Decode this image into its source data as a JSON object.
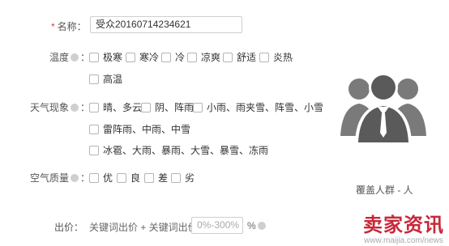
{
  "name_field": {
    "required_mark": "*",
    "label": "名称：",
    "value": "受众20160714234621"
  },
  "temperature": {
    "label": "温度",
    "colon": "：",
    "options": [
      "极寒",
      "寒冷",
      "冷",
      "凉爽",
      "舒适",
      "炎热",
      "高温"
    ]
  },
  "weather": {
    "label": "天气现象",
    "colon": "：",
    "options": [
      "晴、多云",
      "阴、阵雨",
      "小雨、雨夹雪、阵雪、小雪",
      "雷阵雨、中雨、中雪",
      "冰雹、大雨、暴雨、大雪、暴雪、冻雨"
    ]
  },
  "air_quality": {
    "label": "空气质量",
    "colon": "：",
    "options": [
      "优",
      "良",
      "差",
      "劣"
    ]
  },
  "bid": {
    "label": "出价：",
    "formula": "关键词出价 + 关键词出价 x",
    "placeholder": "0%-300%",
    "unit": "%"
  },
  "audience": {
    "caption": "覆盖人群 - 人",
    "icon": "people-group-icon"
  },
  "watermark": {
    "title": "卖家资讯",
    "url": "www.maijia.com/news"
  }
}
